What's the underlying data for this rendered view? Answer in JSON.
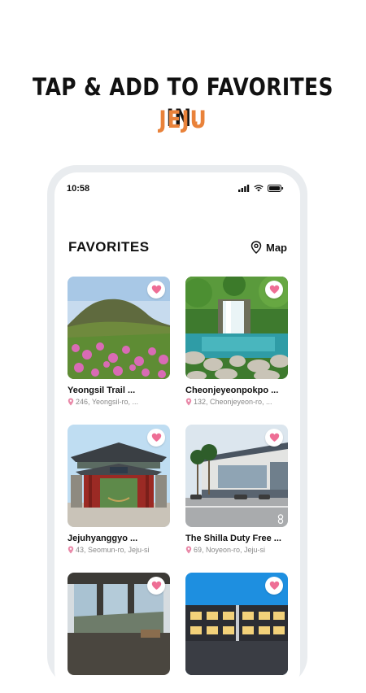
{
  "headline": {
    "line1": "TAP & ADD TO FAVORITES IN",
    "line1_dot": ".",
    "line2": "JEJU"
  },
  "colors": {
    "accent": "#E9823A",
    "heart": "#EE6E95",
    "pin": "#E98AA9"
  },
  "status_bar": {
    "time": "10:58",
    "icons": [
      "signal-icon",
      "wifi-icon",
      "battery-icon"
    ]
  },
  "header": {
    "title": "FAVORITES",
    "map_label": "Map"
  },
  "cards": [
    {
      "name": "Yeongsil Trail ...",
      "address": "246, Yeongsil-ro, ..."
    },
    {
      "name": "Cheonjeyeonpokpo ...",
      "address": "132, Cheonjeyeon-ro, ..."
    },
    {
      "name": "Jejuhyanggyo ...",
      "address": "43, Seomun-ro, Jeju-si"
    },
    {
      "name": "The Shilla Duty Free ...",
      "address": "69, Noyeon-ro, Jeju-si"
    },
    {
      "name": "",
      "address": ""
    },
    {
      "name": "",
      "address": ""
    }
  ]
}
